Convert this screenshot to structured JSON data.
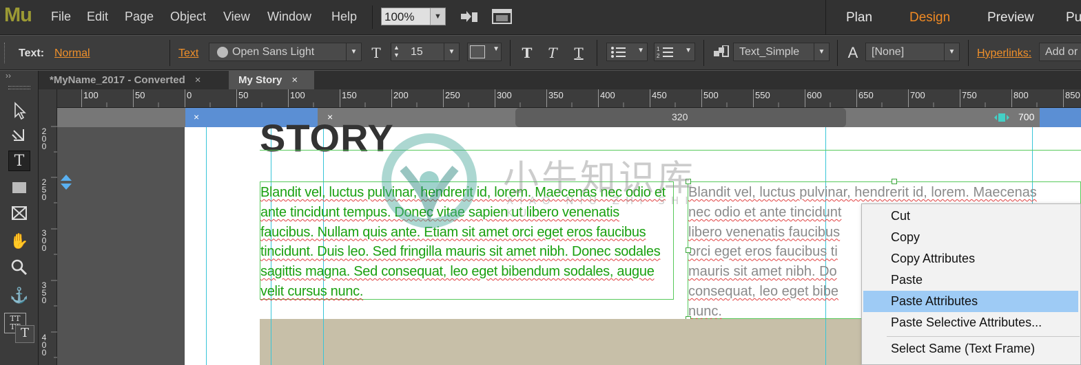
{
  "app": {
    "logo": "Mu"
  },
  "menu": {
    "items": [
      "File",
      "Edit",
      "Page",
      "Object",
      "View",
      "Window",
      "Help"
    ],
    "zoom": "100%",
    "modes": [
      "Plan",
      "Design",
      "Preview",
      "Pu"
    ],
    "active_mode": "Design"
  },
  "control": {
    "text_label": "Text:",
    "style_link": "Normal",
    "text_link": "Text",
    "font": "Open Sans Light",
    "size": "15",
    "paragraph_style": "Text_Simple",
    "char_style": "[None]",
    "hyperlinks_label": "Hyperlinks:",
    "add_link": "Add or"
  },
  "tabs": [
    {
      "label": "*MyName_2017 - Converted",
      "close": "×"
    },
    {
      "label": "My Story",
      "close": "×"
    }
  ],
  "ruler": {
    "h_labels": [
      "100",
      "50",
      "0",
      "50",
      "100",
      "150",
      "200",
      "250",
      "300",
      "350",
      "400",
      "450",
      "500",
      "550",
      "600",
      "650",
      "700",
      "750",
      "800",
      "850"
    ],
    "v_labels": [
      "200",
      "250",
      "300",
      "350",
      "400"
    ]
  },
  "breakpoints": {
    "close_a": "×",
    "close_b": "×",
    "range_value": "320",
    "right_value": "700"
  },
  "canvas": {
    "heading": "STORY",
    "green_text": "Blandit vel, luctus pulvinar, hendrerit id, lorem. Maecenas nec odio et ante tincidunt tempus. Donec vitae sapien ut libero venenatis faucibus. Nullam quis ante. Etiam sit amet orci eget eros faucibus tincidunt. Duis leo. Sed fringilla mauris sit amet nibh. Donec sodales sagittis magna. Sed consequat, leo eget bibendum sodales, augue velit cursus nunc.",
    "gray_lines": [
      "Blandit vel, luctus pulvinar, hendrerit id, lorem. Maecenas",
      "nec odio et ante tincidunt",
      "libero venenatis faucibus",
      "orci eget eros faucibus ti",
      "mauris sit amet nibh. Do",
      "consequat, leo eget bibe",
      "nunc."
    ]
  },
  "watermark": {
    "chinese": "小牛知识库",
    "pinyin": "XIAO NIU ZHI SHI KU"
  },
  "context_menu": {
    "items": [
      "Cut",
      "Copy",
      "Copy Attributes",
      "Paste",
      "Paste Attributes",
      "Paste Selective Attributes...",
      "Select Same (Text Frame)"
    ],
    "highlighted": "Paste Attributes"
  },
  "colors": {
    "accent": "#f08a24",
    "highlight": "#9ecbf5",
    "guide": "#37c5d8",
    "frame": "#56c95a",
    "green_text": "#1aa010"
  }
}
